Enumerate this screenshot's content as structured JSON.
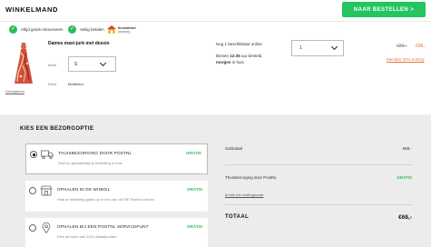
{
  "header": {
    "title": "WINKELMAND",
    "checkout_label": "NAAR BESTELLEN >"
  },
  "trust": {
    "returns": "Altijd gratis retourneren",
    "payment": "Veilig betalen",
    "thuiswinkel_logo_text": "thuiswinkel waarborg"
  },
  "item": {
    "name": "Dames maxi-jurk met dessin",
    "size_label": "Maat",
    "size_value": "S",
    "color_label": "Kleur",
    "color_value": "Multikleur",
    "remove_label": "Verwijderen",
    "stock": "Nog 1 beschikbaar online",
    "delivery_prefix": "Binnen ",
    "delivery_time": "12:35",
    "delivery_suffix": " uur besteld,",
    "delivery_day": "morgen",
    "delivery_end": " in huis",
    "quantity": "1",
    "old_price": "€85,-",
    "new_price": "€68,-",
    "discount_link": "Member 20% korting"
  },
  "delivery": {
    "section_title": "KIES EEN BEZORGOPTIE",
    "options": [
      {
        "title": "THUISBEZORGING DOOR POSTNL",
        "desc": "Snel en gemakkelijk je bestelling in huis",
        "price": "GRATIS",
        "icon": "truck-icon",
        "selected": true
      },
      {
        "title": "OPHALEN IN DE WINKEL",
        "desc": "Haal je bestelling gratis op in een van de WE Fashion stores",
        "price": "GRATIS",
        "icon": "store-icon",
        "selected": false
      },
      {
        "title": "OPHALEN BIJ EEN POSTNL SERVICEPUNT",
        "desc": "Kies uit meer dan 3310 afhaalpunten",
        "price": "GRATIS",
        "icon": "location-pin-icon",
        "selected": false
      }
    ]
  },
  "summary": {
    "subtotal_label": "Subtotaal",
    "subtotal_value": "€68,-",
    "shipping_label": "Thuisbezorging door PostNL",
    "shipping_value": "GRATIS",
    "code_link": "Ik heb een kortingscode",
    "total_label": "TOTAAL",
    "total_value": "€68,-"
  },
  "colors": {
    "accent_green": "#22c55e",
    "check_green": "#2dbb5b",
    "sale_orange": "#e4773a",
    "panel_gray": "#ececec"
  }
}
